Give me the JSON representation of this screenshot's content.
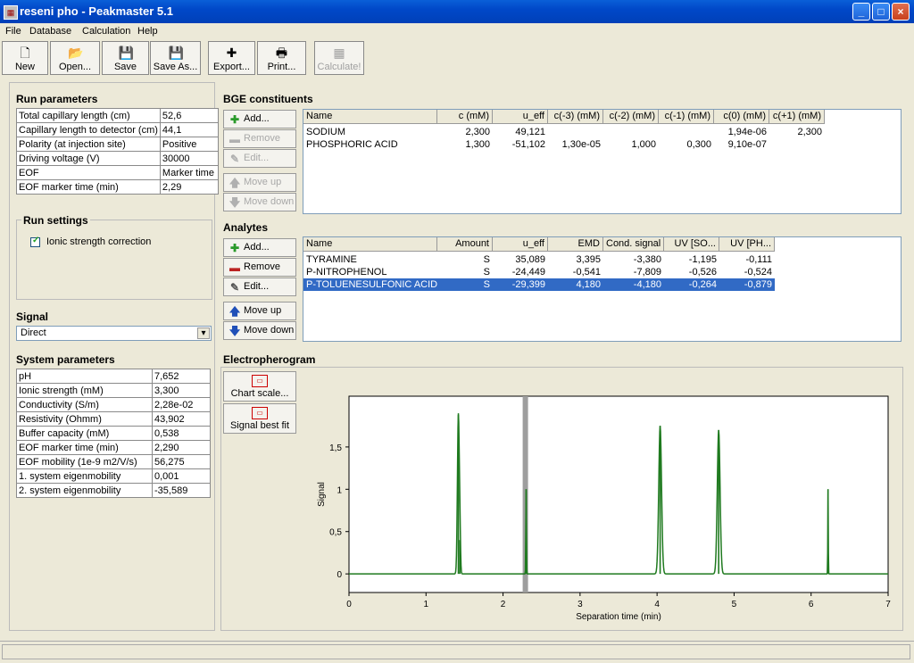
{
  "window": {
    "title": "reseni pho - Peakmaster 5.1",
    "minimize": "_",
    "maximize": "□",
    "close": "×"
  },
  "menu": [
    "File",
    "Database",
    "Calculation",
    "Help"
  ],
  "toolbar": [
    {
      "label": "New",
      "icon": "new-file-icon",
      "glyph": "🗋",
      "enabled": true
    },
    {
      "label": "Open...",
      "icon": "open-folder-icon",
      "glyph": "📂",
      "enabled": true
    },
    {
      "label": "Save",
      "icon": "floppy-disk-icon",
      "glyph": "💾",
      "enabled": true
    },
    {
      "label": "Save As...",
      "icon": "floppy-disk-icon",
      "glyph": "💾",
      "enabled": true
    },
    {
      "label": "Export...",
      "icon": "export-icon",
      "glyph": "✚",
      "enabled": true
    },
    {
      "label": "Print...",
      "icon": "printer-icon",
      "glyph": "🖶",
      "enabled": true
    },
    {
      "label": "Calculate!",
      "icon": "calculator-icon",
      "glyph": "▦",
      "enabled": false
    }
  ],
  "run_parameters": {
    "title": "Run parameters",
    "rows": [
      {
        "label": "Total capillary length (cm)",
        "value": "52,6"
      },
      {
        "label": "Capillary length to detector (cm)",
        "value": "44,1"
      },
      {
        "label": "Polarity (at injection site)",
        "value": "Positive"
      },
      {
        "label": "Driving voltage (V)",
        "value": "30000"
      },
      {
        "label": "EOF",
        "value": "Marker time"
      },
      {
        "label": "EOF marker time (min)",
        "value": "2,29"
      }
    ]
  },
  "run_settings": {
    "title": "Run settings",
    "checkbox_label": "Ionic strength correction",
    "checked": true,
    "check_glyph": "✓"
  },
  "signal": {
    "title": "Signal",
    "value": "Direct",
    "arrow": "▾"
  },
  "system_parameters": {
    "title": "System parameters",
    "rows": [
      {
        "label": "pH",
        "value": "7,652"
      },
      {
        "label": "Ionic strength (mM)",
        "value": "3,300"
      },
      {
        "label": "Conductivity (S/m)",
        "value": "2,28e-02"
      },
      {
        "label": "Resistivity (Ohmm)",
        "value": "43,902"
      },
      {
        "label": "Buffer capacity (mM)",
        "value": "0,538"
      },
      {
        "label": "EOF marker time (min)",
        "value": "2,290"
      },
      {
        "label": "EOF mobility (1e-9 m2/V/s)",
        "value": "56,275"
      },
      {
        "label": "1. system eigenmobility",
        "value": "0,001"
      },
      {
        "label": "2. system eigenmobility",
        "value": "-35,589"
      }
    ]
  },
  "bge": {
    "title": "BGE constituents",
    "buttons": [
      {
        "label": "Add...",
        "glyph": "✚",
        "enabled": true
      },
      {
        "label": "Remove",
        "glyph": "▬",
        "enabled": false
      },
      {
        "label": "Edit...",
        "glyph": "✎",
        "enabled": false
      },
      {
        "label": "Move up",
        "glyph": "🡅",
        "enabled": false
      },
      {
        "label": "Move down",
        "glyph": "🡇",
        "enabled": false
      }
    ],
    "columns": [
      "Name",
      "c (mM)",
      "u_eff",
      "c(-3) (mM)",
      "c(-2) (mM)",
      "c(-1) (mM)",
      "c(0) (mM)",
      "c(+1) (mM)"
    ],
    "rows": [
      [
        "SODIUM",
        "2,300",
        "49,121",
        "",
        "",
        "",
        "1,94e-06",
        "2,300"
      ],
      [
        "PHOSPHORIC ACID",
        "1,300",
        "-51,102",
        "1,30e-05",
        "1,000",
        "0,300",
        "9,10e-07",
        ""
      ]
    ]
  },
  "analytes": {
    "title": "Analytes",
    "buttons": [
      {
        "label": "Add...",
        "glyph": "✚",
        "enabled": true
      },
      {
        "label": "Remove",
        "glyph": "▬",
        "enabled": true
      },
      {
        "label": "Edit...",
        "glyph": "✎",
        "enabled": true
      },
      {
        "label": "Move up",
        "glyph": "🡅",
        "enabled": true
      },
      {
        "label": "Move down",
        "glyph": "🡇",
        "enabled": true
      }
    ],
    "columns": [
      "Name",
      "Amount",
      "u_eff",
      "EMD",
      "Cond. signal",
      "UV [SO...",
      "UV [PH..."
    ],
    "rows": [
      [
        "TYRAMINE",
        "S",
        "35,089",
        "3,395",
        "-3,380",
        "-1,195",
        "-0,111"
      ],
      [
        "P-NITROPHENOL",
        "S",
        "-24,449",
        "-0,541",
        "-7,809",
        "-0,526",
        "-0,524"
      ],
      [
        "P-TOLUENESULFONIC ACID",
        "S",
        "-29,399",
        "4,180",
        "-4,180",
        "-0,264",
        "-0,879"
      ]
    ],
    "selected_row": 2
  },
  "electropherogram": {
    "title": "Electropherogram",
    "buttons": [
      {
        "label": "Chart scale...",
        "glyph": "▭"
      },
      {
        "label": "Signal best fit",
        "glyph": "▭"
      }
    ]
  },
  "colors": {
    "selection": "#316ac5",
    "trace": "#1f7a1f",
    "marker_band": "#9e9e9e"
  },
  "chart_data": {
    "type": "line",
    "xlabel": "Separation time (min)",
    "ylabel": "Signal",
    "xlim": [
      0,
      7
    ],
    "ylim": [
      -0.22,
      2.1
    ],
    "xticks": [
      0,
      1,
      2,
      3,
      4,
      5,
      6,
      7
    ],
    "yticks": [
      0,
      0.5,
      1,
      1.5
    ],
    "ytick_labels": [
      "0",
      "0,5",
      "1",
      "1,5"
    ],
    "eof_marker_time": 2.29,
    "peaks": [
      {
        "x": 1.42,
        "height": 1.88,
        "width": 0.012
      },
      {
        "x": 1.44,
        "height": 0.4,
        "width": 0.008
      },
      {
        "x": 2.3,
        "height": 1.0,
        "width": 0.004
      },
      {
        "x": 4.04,
        "height": 1.75,
        "width": 0.018
      },
      {
        "x": 4.8,
        "height": 1.7,
        "width": 0.018
      },
      {
        "x": 6.22,
        "height": 1.0,
        "width": 0.003
      }
    ]
  }
}
